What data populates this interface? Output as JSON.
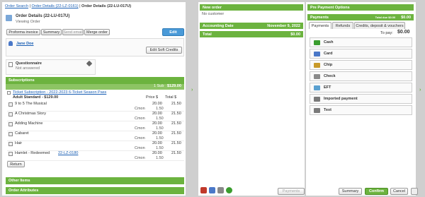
{
  "breadcrumb": {
    "items": [
      "Order Search",
      "Order Details (22-LZ-0161)",
      "Order Details (22-LU-017U)"
    ]
  },
  "order": {
    "title": "Order Details (22-LU-017U)",
    "subtitle": "Viewing Order",
    "edit_label": "Edit"
  },
  "toolbar": {
    "proforma": "Proforma invoice",
    "summary": "Summary",
    "send_email": "Send email",
    "merge": "Merge order"
  },
  "customer": {
    "name": "Jane Doe",
    "edit_soft_credits": "Edit Soft Credits"
  },
  "questionnaire": {
    "title": "Questionnaire",
    "status": "Not answered"
  },
  "subscriptions": {
    "header": "Subscriptions",
    "count": "1 Sub",
    "total": "$129.00",
    "item_link": "Ticket Subscription - 2022-2023 6-Ticket Season Pass",
    "package": "Adult Standard - $129.00",
    "col_price": "Price $",
    "col_total": "Total $",
    "rows": [
      {
        "name": "9 to 5 The Musical",
        "link": false,
        "price": "20.00",
        "total": "21.50",
        "cm": "Cmon",
        "fee": "1.50"
      },
      {
        "name": "A Christmas Story",
        "link": false,
        "price": "20.00",
        "total": "21.50",
        "cm": "Cmon",
        "fee": "1.50"
      },
      {
        "name": "Adding Machine",
        "link": false,
        "price": "20.00",
        "total": "21.50",
        "cm": "Cmon",
        "fee": "1.50"
      },
      {
        "name": "Cabaret",
        "link": false,
        "price": "20.00",
        "total": "21.50",
        "cm": "Cmon",
        "fee": "1.50"
      },
      {
        "name": "Hair",
        "link": false,
        "price": "20.00",
        "total": "21.50",
        "cm": "Cmon",
        "fee": "1.50"
      },
      {
        "name": "Hamlet - Redeemed",
        "link_text": "22-LZ-0180",
        "link": true,
        "price": "20.00",
        "total": "21.50",
        "cm": "Cmon",
        "fee": "1.50"
      }
    ],
    "return_label": "Return"
  },
  "other_items": "Other Items",
  "order_attributes": "Order Attributes",
  "new_order": {
    "title": "New order",
    "customer": "No customer",
    "accounting_date_label": "Accounting Date",
    "accounting_date": "November 9, 2022",
    "total_label": "Total",
    "total_value": "$0.00"
  },
  "payment": {
    "pre_options": "Pre Payment Options",
    "header": "Payments",
    "total_due": "Total due $0.00",
    "amount": "$0.00",
    "tabs": [
      "Payments",
      "Refunds",
      "Credits, deposit & vouchers"
    ],
    "to_pay_label": "To pay:",
    "to_pay": "$0.00",
    "methods": [
      {
        "label": "Cash",
        "color": "#3a9d2e"
      },
      {
        "label": "Card",
        "color": "#4a78c8"
      },
      {
        "label": "Chip",
        "color": "#c89a2a"
      },
      {
        "label": "Check",
        "color": "#8a8a8a"
      },
      {
        "label": "EFT",
        "color": "#5aa0d0"
      },
      {
        "label": "Imported payment",
        "color": "#7a7a7a"
      },
      {
        "label": "Text",
        "color": "#7a7a7a"
      }
    ]
  },
  "footer": {
    "payments": "Payments",
    "summary": "Summary",
    "confirm": "Confirm",
    "cancel": "Cancel"
  },
  "colors": {
    "accent": "#6cb33f",
    "link": "#1a5fb4",
    "edit": "#4a9ad8"
  }
}
